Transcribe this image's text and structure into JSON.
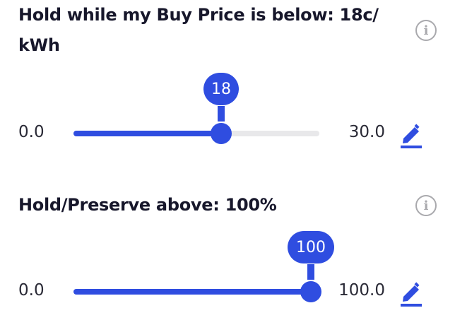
{
  "accent_color": "#2f4de0",
  "sliders": [
    {
      "title": "Hold while my Buy Price is below: 18c/\nkWh",
      "min_label": "0.0",
      "max_label": "30.0",
      "min": 0,
      "max": 30,
      "value": 18,
      "value_label": "18",
      "info_icon": "info-icon",
      "edit_icon": "pencil-icon"
    },
    {
      "title": "Hold/Preserve above: 100%",
      "min_label": "0.0",
      "max_label": "100.0",
      "min": 0,
      "max": 100,
      "value": 100,
      "value_label": "100",
      "info_icon": "info-icon",
      "edit_icon": "pencil-icon"
    }
  ]
}
